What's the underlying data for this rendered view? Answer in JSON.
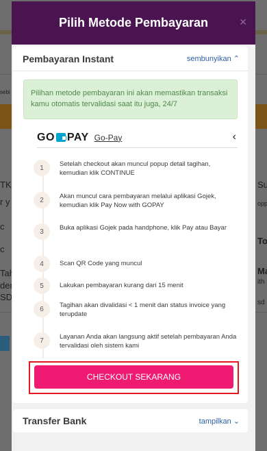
{
  "background": {
    "fragments": [
      "sebi",
      "TKA",
      "r y",
      "c",
      "c",
      "Tah",
      "der",
      "SD",
      "Su",
      "opp",
      "To",
      "Ma",
      "ith",
      "sd"
    ]
  },
  "modal": {
    "title": "Pilih Metode Pembayaran",
    "close_icon": "close-icon"
  },
  "instant": {
    "title": "Pembayaran Instant",
    "toggle_label": "sembunyikan",
    "notice": "Pilihan metode pembayaran ini akan memastikan transaksi kamu otomatis tervalidasi saat itu juga, 24/7",
    "gopay": {
      "logo_left": "GO",
      "logo_right": "PAY",
      "name": "Go-Pay"
    },
    "steps": [
      {
        "num": "1",
        "text": "Setelah checkout akan muncul popup detail tagihan, kemudian klik CONTINUE"
      },
      {
        "num": "2",
        "text": "Akan muncul cara pembayaran melalui aplikasi Gojek, kemudian klik Pay Now with GOPAY"
      },
      {
        "num": "3",
        "text": "Buka aplikasi Gojek pada handphone, klik Pay atau Bayar"
      },
      {
        "num": "4",
        "text": "Scan QR Code yang muncul"
      },
      {
        "num": "5",
        "text": "Lakukan pembayaran kurang dari 15 menit"
      },
      {
        "num": "6",
        "text": "Tagihan akan divalidasi < 1 menit dan status invoice yang terupdate"
      },
      {
        "num": "7",
        "text": "Layanan Anda akan langsung aktif setelah pembayaran Anda tervalidasi oleh sistem kami"
      }
    ],
    "cta_label": "CHECKOUT SEKARANG"
  },
  "transfer": {
    "title": "Transfer Bank",
    "toggle_label": "tampilkan"
  },
  "colors": {
    "header": "#4a1450",
    "cta": "#ef1b72",
    "highlight": "#e4161e",
    "notice_bg": "#dbf0d6",
    "link": "#2b5fa6"
  }
}
